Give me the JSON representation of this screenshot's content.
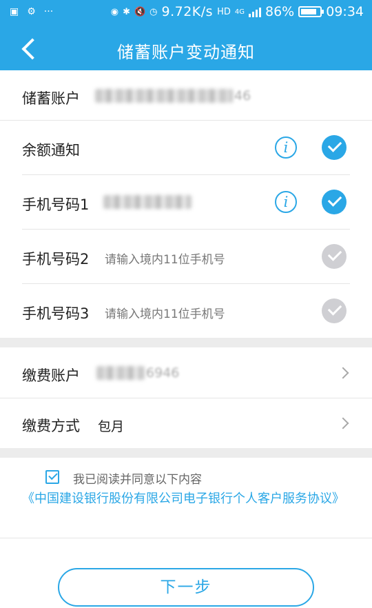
{
  "status_bar": {
    "network_speed": "9.72K/s",
    "hd_label": "HD",
    "net_type": "4G",
    "battery": "86%",
    "battery_level": 0.86,
    "time": "09:34",
    "more_label": "···",
    "icons": [
      "image-icon",
      "gear-icon",
      "location-icon",
      "bluetooth-icon",
      "mute-icon",
      "alarm-icon",
      "signal-icon",
      "battery-icon"
    ]
  },
  "nav": {
    "title": "储蓄账户变动通知",
    "back_icon": "back-arrow-icon"
  },
  "savings_account": {
    "label": "储蓄账户",
    "masked_suffix": "46"
  },
  "balance_notify": {
    "label": "余额通知",
    "info_icon": "i",
    "checked": true
  },
  "phone1": {
    "label": "手机号码1",
    "checked": true
  },
  "phone2": {
    "label": "手机号码2",
    "placeholder": "请输入境内11位手机号",
    "checked": false
  },
  "phone3": {
    "label": "手机号码3",
    "placeholder": "请输入境内11位手机号",
    "checked": false
  },
  "payment_account": {
    "label": "缴费账户",
    "masked_suffix": "6946"
  },
  "payment_method": {
    "label": "缴费方式",
    "value": "包月"
  },
  "agreement": {
    "checked": true,
    "text": "我已阅读并同意以下内容",
    "link": "《中国建设银行股份有限公司电子银行个人客户服务协议》"
  },
  "next_button": {
    "label": "下一步"
  },
  "colors": {
    "accent": "#2aa7e6",
    "check_off": "#cfcfd3",
    "section_gap": "#ececec"
  }
}
